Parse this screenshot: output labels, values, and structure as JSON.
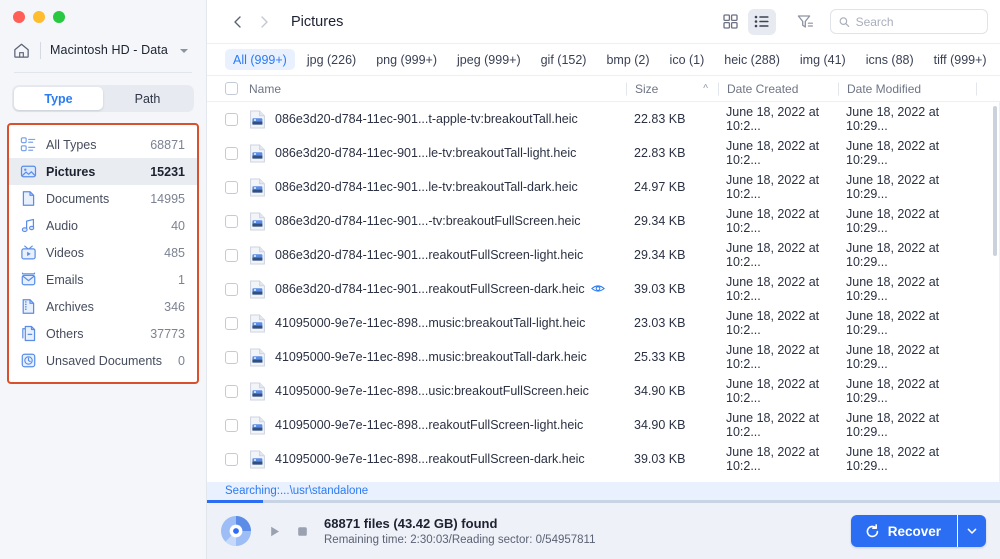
{
  "window": {
    "traffic_lights": [
      "close",
      "minimize",
      "zoom"
    ],
    "colors": {
      "accent_blue": "#2b7bf3",
      "button_blue": "#2b6ef3",
      "annotation_red": "#d9512c",
      "sidebar_bg": "#f4f6f9",
      "statusbar_bg": "#eef1f7",
      "highlight_bg": "#e9f0fe"
    }
  },
  "sidebar": {
    "drive_label": "Macintosh HD - Data",
    "segmented": {
      "options": [
        "Type",
        "Path"
      ],
      "selected": "Type"
    },
    "types": [
      {
        "icon": "all-types-icon",
        "label": "All Types",
        "count": "68871",
        "selected": false
      },
      {
        "icon": "pictures-icon",
        "label": "Pictures",
        "count": "15231",
        "selected": true
      },
      {
        "icon": "documents-icon",
        "label": "Documents",
        "count": "14995",
        "selected": false
      },
      {
        "icon": "audio-icon",
        "label": "Audio",
        "count": "40",
        "selected": false
      },
      {
        "icon": "videos-icon",
        "label": "Videos",
        "count": "485",
        "selected": false
      },
      {
        "icon": "emails-icon",
        "label": "Emails",
        "count": "1",
        "selected": false
      },
      {
        "icon": "archives-icon",
        "label": "Archives",
        "count": "346",
        "selected": false
      },
      {
        "icon": "others-icon",
        "label": "Others",
        "count": "37773",
        "selected": false
      },
      {
        "icon": "unsaved-documents-icon",
        "label": "Unsaved Documents",
        "count": "0",
        "selected": false
      }
    ]
  },
  "topbar": {
    "back_icon": "chevron-left-icon",
    "forward_icon": "chevron-right-icon",
    "breadcrumb": "Pictures",
    "grid_view_icon": "grid-view-icon",
    "list_view_icon": "list-view-icon",
    "active_view": "list",
    "filter_icon": "funnel-filter-icon",
    "search": {
      "icon": "search-icon",
      "value": "",
      "placeholder": "Search"
    }
  },
  "filter_tabs": {
    "items": [
      {
        "label": "All (999+)",
        "active": true
      },
      {
        "label": "jpg (226)",
        "active": false
      },
      {
        "label": "png (999+)",
        "active": false
      },
      {
        "label": "jpeg (999+)",
        "active": false
      },
      {
        "label": "gif (152)",
        "active": false
      },
      {
        "label": "bmp (2)",
        "active": false
      },
      {
        "label": "ico (1)",
        "active": false
      },
      {
        "label": "heic (288)",
        "active": false
      },
      {
        "label": "img (41)",
        "active": false
      },
      {
        "label": "icns (88)",
        "active": false
      },
      {
        "label": "tiff (999+)",
        "active": false
      }
    ],
    "more_icon": "more-options-icon"
  },
  "table": {
    "headers": {
      "name": "Name",
      "size": "Size",
      "date_created": "Date Created",
      "date_modified": "Date Modified",
      "sort_caret": "^"
    },
    "rows": [
      {
        "name": "086e3d20-d784-11ec-901...t-apple-tv:breakoutTall.heic",
        "size": "22.83 KB",
        "created": "June 18, 2022 at 10:2...",
        "modified": "June 18, 2022 at 10:29...",
        "preview": false
      },
      {
        "name": "086e3d20-d784-11ec-901...le-tv:breakoutTall-light.heic",
        "size": "22.83 KB",
        "created": "June 18, 2022 at 10:2...",
        "modified": "June 18, 2022 at 10:29...",
        "preview": false
      },
      {
        "name": "086e3d20-d784-11ec-901...le-tv:breakoutTall-dark.heic",
        "size": "24.97 KB",
        "created": "June 18, 2022 at 10:2...",
        "modified": "June 18, 2022 at 10:29...",
        "preview": false
      },
      {
        "name": "086e3d20-d784-11ec-901...-tv:breakoutFullScreen.heic",
        "size": "29.34 KB",
        "created": "June 18, 2022 at 10:2...",
        "modified": "June 18, 2022 at 10:29...",
        "preview": false
      },
      {
        "name": "086e3d20-d784-11ec-901...reakoutFullScreen-light.heic",
        "size": "29.34 KB",
        "created": "June 18, 2022 at 10:2...",
        "modified": "June 18, 2022 at 10:29...",
        "preview": false
      },
      {
        "name": "086e3d20-d784-11ec-901...reakoutFullScreen-dark.heic",
        "size": "39.03 KB",
        "created": "June 18, 2022 at 10:2...",
        "modified": "June 18, 2022 at 10:29...",
        "preview": true
      },
      {
        "name": "41095000-9e7e-11ec-898...music:breakoutTall-light.heic",
        "size": "23.03 KB",
        "created": "June 18, 2022 at 10:2...",
        "modified": "June 18, 2022 at 10:29...",
        "preview": false
      },
      {
        "name": "41095000-9e7e-11ec-898...music:breakoutTall-dark.heic",
        "size": "25.33 KB",
        "created": "June 18, 2022 at 10:2...",
        "modified": "June 18, 2022 at 10:29...",
        "preview": false
      },
      {
        "name": "41095000-9e7e-11ec-898...usic:breakoutFullScreen.heic",
        "size": "34.90 KB",
        "created": "June 18, 2022 at 10:2...",
        "modified": "June 18, 2022 at 10:29...",
        "preview": false
      },
      {
        "name": "41095000-9e7e-11ec-898...reakoutFullScreen-light.heic",
        "size": "34.90 KB",
        "created": "June 18, 2022 at 10:2...",
        "modified": "June 18, 2022 at 10:29...",
        "preview": false
      },
      {
        "name": "41095000-9e7e-11ec-898...reakoutFullScreen-dark.heic",
        "size": "39.03 KB",
        "created": "June 18, 2022 at 10:2...",
        "modified": "June 18, 2022 at 10:29...",
        "preview": false
      }
    ]
  },
  "scan": {
    "searching_label": "Searching:...\\usr\\standalone",
    "progress_percent": 7,
    "found_title": "68871 files (43.42 GB) found",
    "found_sub": "Remaining time: 2:30:03/Reading sector: 0/54957811",
    "play_icon": "play-icon",
    "stop_icon": "stop-icon",
    "disc_icon": "scanning-disc-icon"
  },
  "actions": {
    "recover_label": "Recover",
    "recover_icon": "refresh-recover-icon",
    "dropdown_icon": "chevron-down-icon"
  }
}
